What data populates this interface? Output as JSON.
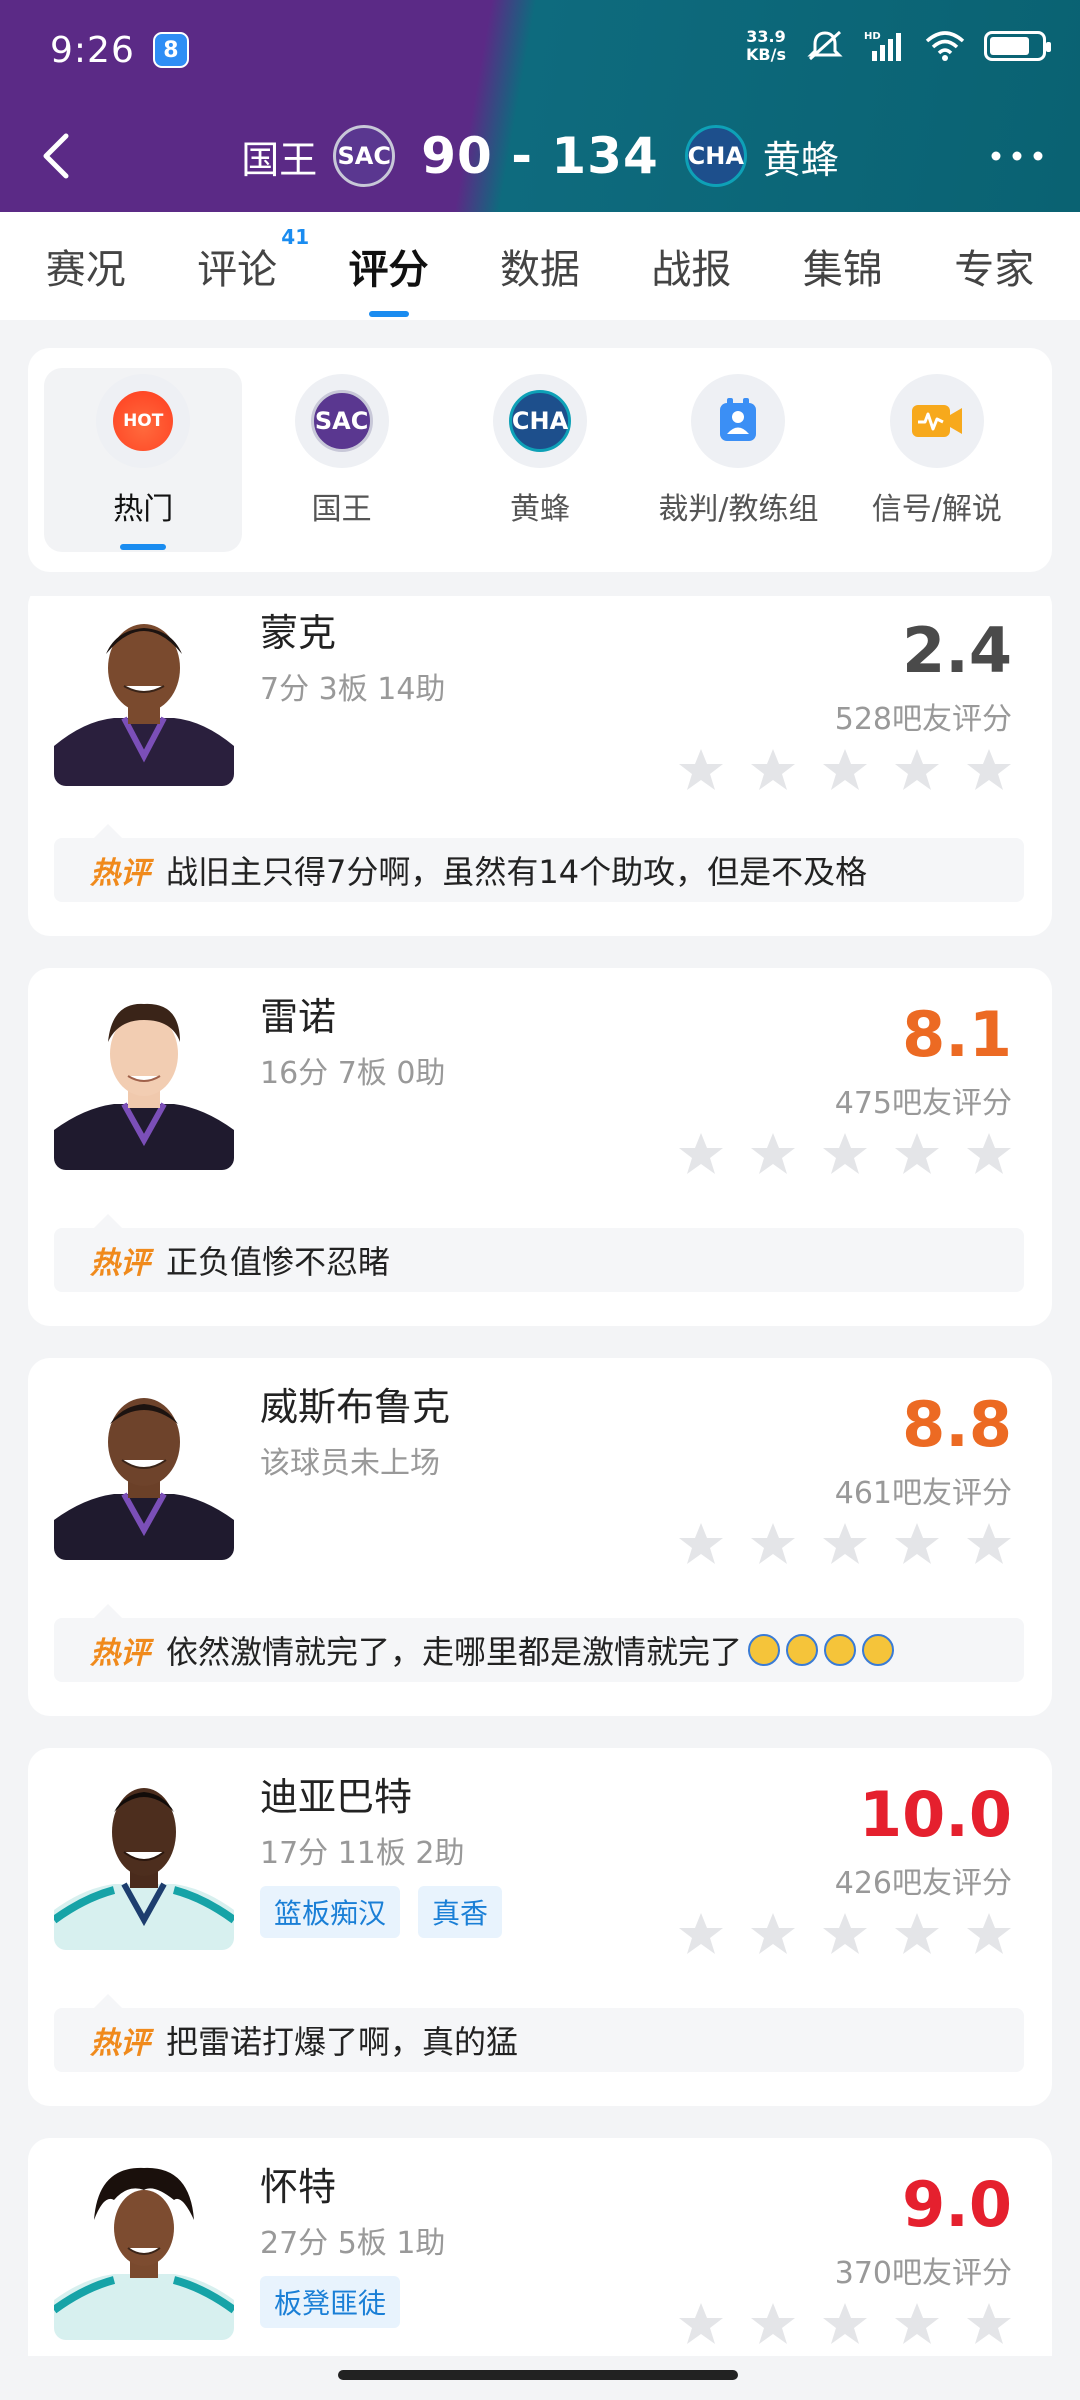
{
  "status_bar": {
    "time": "9:26",
    "notif_badge": "8",
    "net_speed_value": "33.9",
    "net_speed_unit": "KB/s",
    "hd_label": "HD"
  },
  "game": {
    "home_team": "国王",
    "home_abbr": "SAC",
    "away_team": "黄蜂",
    "away_abbr": "CHA",
    "score": "90 - 134"
  },
  "tabs": [
    {
      "label": "赛况"
    },
    {
      "label": "评论",
      "badge": "41"
    },
    {
      "label": "评分"
    },
    {
      "label": "数据"
    },
    {
      "label": "战报"
    },
    {
      "label": "集锦"
    },
    {
      "label": "专家"
    }
  ],
  "filters": [
    {
      "label": "热门",
      "icon": "hot-icon",
      "badge": "HOT"
    },
    {
      "label": "国王",
      "icon": "sac-logo-icon",
      "badge": "SAC"
    },
    {
      "label": "黄蜂",
      "icon": "cha-logo-icon",
      "badge": "CHA"
    },
    {
      "label": "裁判/教练组",
      "icon": "referee-icon"
    },
    {
      "label": "信号/解说",
      "icon": "broadcast-icon"
    }
  ],
  "hot_label": "热评",
  "players": [
    {
      "name": "蒙克",
      "stats": "7分 3板 14助",
      "rating": "2.4",
      "rating_color": "#4a4a4a",
      "count": "528吧友评分",
      "tags": [],
      "jersey": "purple",
      "comment": "战旧主只得7分啊，虽然有14个助攻，但是不及格"
    },
    {
      "name": "雷诺",
      "stats": "16分 7板 0助",
      "rating": "8.1",
      "rating_color": "#ec6a23",
      "count": "475吧友评分",
      "tags": [],
      "jersey": "purple",
      "comment": "正负值惨不忍睹"
    },
    {
      "name": "威斯布鲁克",
      "stats": "该球员未上场",
      "rating": "8.8",
      "rating_color": "#ec6a23",
      "count": "461吧友评分",
      "tags": [],
      "jersey": "purple",
      "comment": "依然激情就完了，走哪里都是激情就完了"
    },
    {
      "name": "迪亚巴特",
      "stats": "17分 11板 2助",
      "rating": "10.0",
      "rating_color": "#e5202e",
      "count": "426吧友评分",
      "tags": [
        "篮板痴汉",
        "真香"
      ],
      "jersey": "teal",
      "comment": "把雷诺打爆了啊，真的猛"
    },
    {
      "name": "怀特",
      "stats": "27分 5板 1助",
      "rating": "9.0",
      "rating_color": "#e5202e",
      "count": "370吧友评分",
      "tags": [
        "板凳匪徒"
      ],
      "jersey": "teal",
      "comment": ""
    }
  ]
}
